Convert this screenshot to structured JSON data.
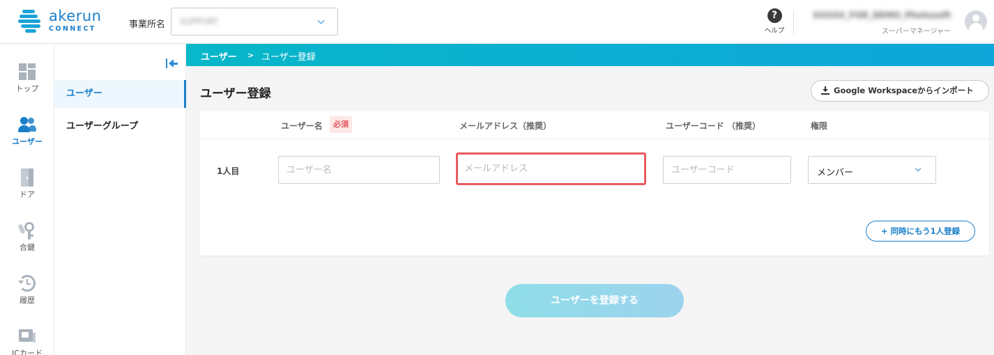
{
  "header": {
    "logo_word": "akerun",
    "logo_sub": "CONNECT",
    "office_label": "事業所名",
    "office_value": "SUPPORT",
    "help_label": "ヘルプ",
    "help_glyph": "?",
    "user_name": "XXXXX_FOR_DEMO_Photosoft",
    "user_role": "スーパーマネージャー"
  },
  "nav": {
    "items": [
      {
        "label": "トップ",
        "icon": "dashboard-icon",
        "active": false
      },
      {
        "label": "ユーザー",
        "icon": "users-icon",
        "active": true
      },
      {
        "label": "ドア",
        "icon": "door-icon",
        "active": false
      },
      {
        "label": "合鍵",
        "icon": "key-icon",
        "active": false
      },
      {
        "label": "履歴",
        "icon": "history-icon",
        "active": false
      },
      {
        "label": "ICカード",
        "icon": "ic-card-icon",
        "active": false
      }
    ]
  },
  "submenu": {
    "items": [
      {
        "label": "ユーザー",
        "active": true
      },
      {
        "label": "ユーザーグループ",
        "active": false
      }
    ]
  },
  "breadcrumb": {
    "parent": "ユーザー",
    "separator": ">",
    "current": "ユーザー登録"
  },
  "main": {
    "title": "ユーザー登録",
    "import_label": "Google Workspaceからインポート",
    "columns": {
      "name": "ユーザー名",
      "required": "必須",
      "email": "メールアドレス（推奨）",
      "code": "ユーザーコード （推奨）",
      "role": "権限"
    },
    "row": {
      "label": "1人目",
      "name_placeholder": "ユーザー名",
      "email_placeholder": "メールアドレス",
      "code_placeholder": "ユーザーコード",
      "role_value": "メンバー"
    },
    "add_label": "+ 同時にもう1人登録",
    "submit_label": "ユーザーを登録する"
  },
  "colors": {
    "accent": "#1a7fc9",
    "breadcrumb_start": "#08b7c9",
    "breadcrumb_end": "#0fa6d9",
    "highlight": "#e85a5f",
    "required_bg": "#fde7e7",
    "required_text": "#e2545b"
  }
}
